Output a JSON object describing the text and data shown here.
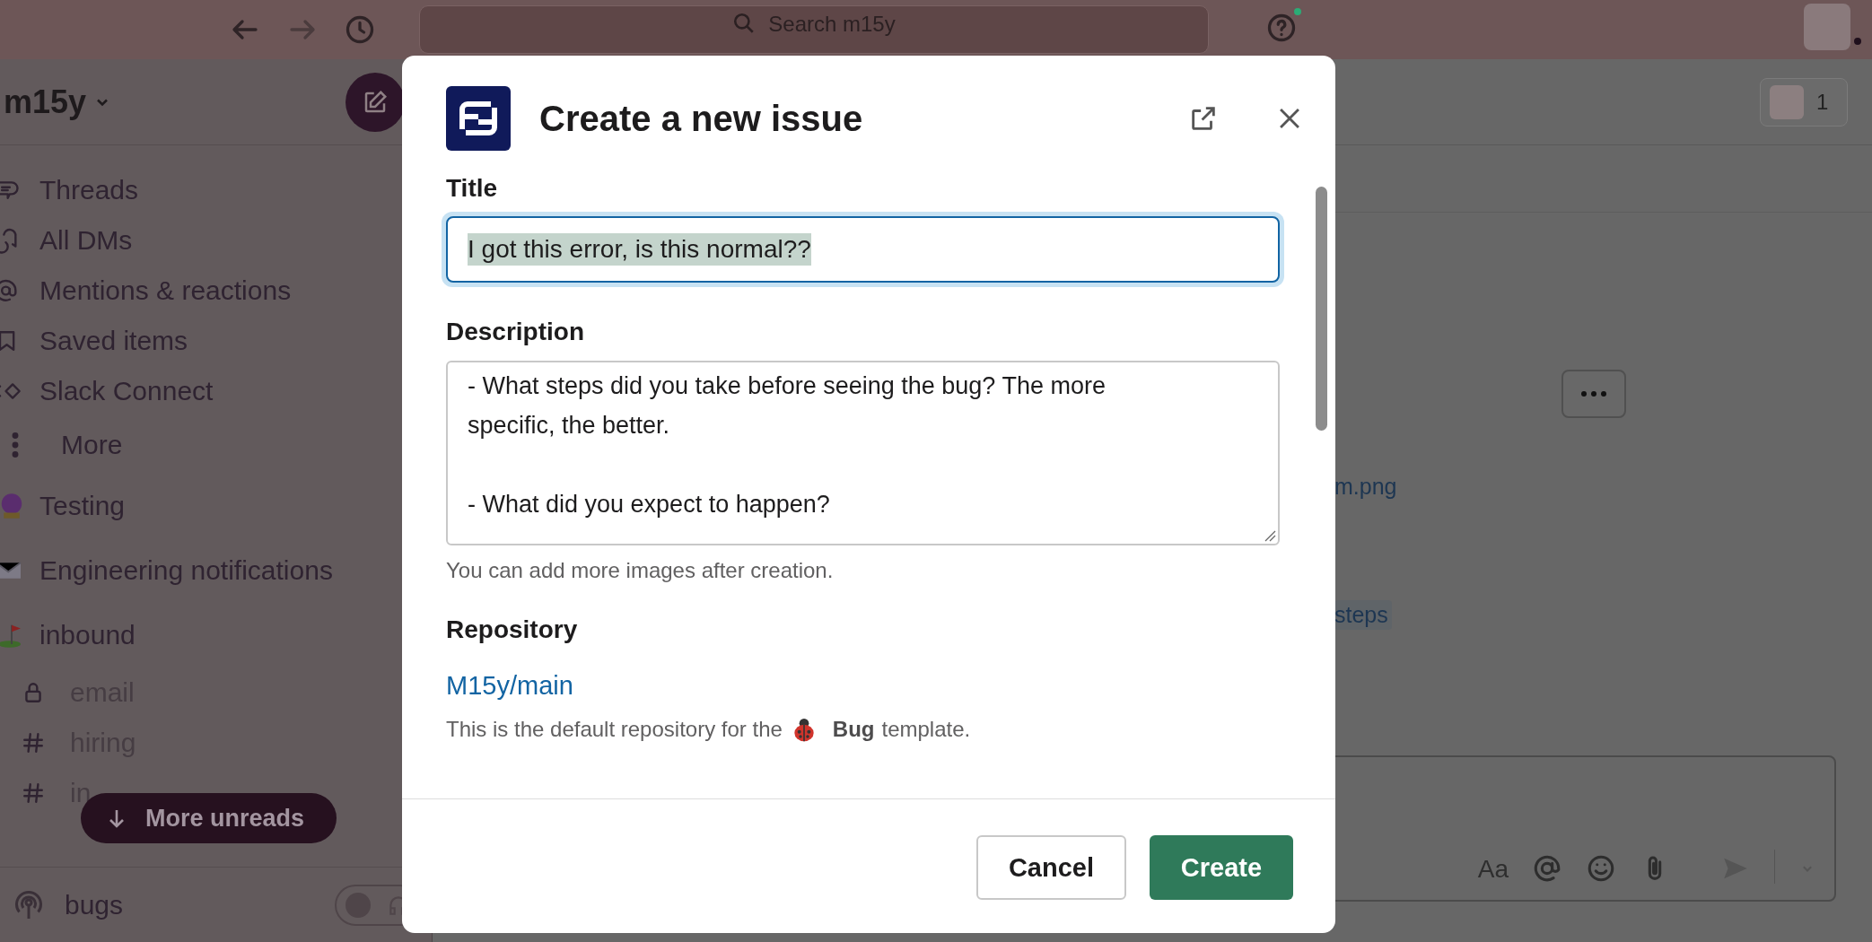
{
  "top_bar": {
    "search_placeholder": "Search m15y"
  },
  "workspace": {
    "name": "m15y"
  },
  "sidebar": {
    "items": [
      {
        "kind": "nav",
        "label": "Threads"
      },
      {
        "kind": "nav",
        "label": "All DMs"
      },
      {
        "kind": "nav",
        "label": "Mentions & reactions"
      },
      {
        "kind": "nav",
        "label": "Saved items"
      },
      {
        "kind": "nav",
        "label": "Slack Connect"
      },
      {
        "kind": "nav",
        "label": "More"
      },
      {
        "kind": "emoji-channel",
        "label": "Testing"
      },
      {
        "kind": "emoji-channel",
        "label": "Engineering notifications"
      },
      {
        "kind": "emoji-channel",
        "label": "inbound"
      },
      {
        "kind": "private-channel",
        "label": "email"
      },
      {
        "kind": "channel",
        "label": "hiring"
      },
      {
        "kind": "channel",
        "label": "in"
      }
    ],
    "more_unreads": "More unreads",
    "huddle": {
      "channel": "bugs",
      "on": false
    }
  },
  "header": {
    "member_count": "1"
  },
  "messages": {
    "links": [
      "m.png",
      "steps"
    ]
  },
  "composer": {
    "format_label": "Aa"
  },
  "dialog": {
    "title": "Create a new issue",
    "title_field": {
      "label": "Title",
      "value": "I got this error, is this normal??",
      "text_selected": true
    },
    "description_field": {
      "label": "Description",
      "value": "- What steps did you take before seeing the bug? The more specific, the better.\n\n- What did you expect to happen?",
      "hint": "You can add more images after creation."
    },
    "repository": {
      "label": "Repository",
      "value": "M15y/main",
      "help_before": "This is the default repository for the",
      "template": "Bug",
      "help_after": "template."
    },
    "buttons": [
      {
        "kind": "secondary",
        "label": "Cancel"
      },
      {
        "kind": "primary",
        "label": "Create"
      }
    ]
  }
}
